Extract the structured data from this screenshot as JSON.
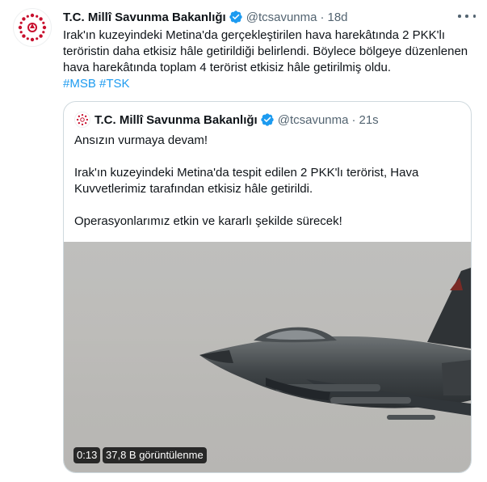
{
  "tweet": {
    "author_name": "T.C. Millî Savunma Bakanlığı",
    "handle": "@tcsavunma",
    "separator": "·",
    "time": "18d",
    "text": "Irak'ın kuzeyindeki Metina'da gerçekleştirilen hava harekâtında 2 PKK'lı teröristin daha etkisiz hâle getirildiği belirlendi. Böylece bölgeye düzenlenen hava harekâtında toplam 4 terörist etkisiz hâle getirilmiş oldu.",
    "hashtags": [
      "#MSB",
      "#TSK"
    ]
  },
  "quoted": {
    "author_name": "T.C. Millî Savunma Bakanlığı",
    "handle": "@tcsavunma",
    "separator": "·",
    "time": "21s",
    "paragraphs": [
      "Ansızın vurmaya devam!",
      "Irak'ın kuzeyindeki Metina'da tespit edilen 2 PKK'lı terörist, Hava Kuvvetlerimiz tarafından etkisiz hâle getirildi.",
      "Operasyonlarımız etkin ve kararlı şekilde sürecek!"
    ],
    "video": {
      "duration": "0:13",
      "views": "37,8 B görüntülenme"
    }
  },
  "colors": {
    "accent": "#1d9bf0",
    "text": "#0f1419",
    "muted": "#536471",
    "border": "#cfd9de",
    "logo_red": "#c8102e"
  },
  "icons": {
    "verified": "verified-badge-icon",
    "more": "more-options-icon",
    "avatar": "msb-logo-icon"
  }
}
